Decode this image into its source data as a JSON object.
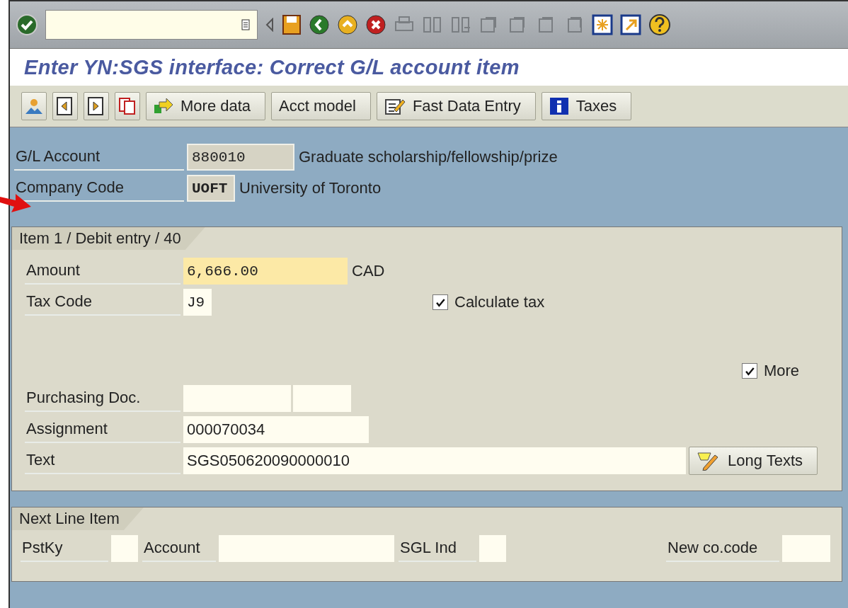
{
  "title": "Enter YN:SGS interface: Correct G/L account item",
  "app_toolbar": [
    {
      "kind": "icon"
    },
    {
      "kind": "icon"
    },
    {
      "kind": "icon"
    },
    {
      "kind": "icon"
    },
    {
      "kind": "text",
      "label": "More data"
    },
    {
      "kind": "text",
      "label": "Acct model"
    },
    {
      "kind": "text",
      "label": "Fast Data Entry"
    },
    {
      "kind": "text",
      "label": "Taxes"
    }
  ],
  "header": [
    {
      "label": "G/L Account",
      "value": "880010",
      "description": "Graduate scholarship/fellowship/prize"
    },
    {
      "label": "Company Code",
      "value": "UOFT",
      "description": "University of Toronto"
    }
  ],
  "item_group": {
    "title": "Item 1 / Debit entry / 40",
    "amount": {
      "label": "Amount",
      "value": "6,666.00",
      "unit": "CAD",
      "kind": "required"
    },
    "tax_code": {
      "label": "Tax Code",
      "value": "J9"
    },
    "calculate_tax": {
      "label": "Calculate tax",
      "checked": true
    },
    "more": {
      "label": "More",
      "checked": true
    },
    "purchasing_doc": {
      "label": "Purchasing Doc."
    },
    "assignment": {
      "label": "Assignment",
      "value": "000070034"
    },
    "text": {
      "label": "Text",
      "value": "SGS050620090000010"
    },
    "long_texts_button": "Long Texts"
  },
  "next_line_item": {
    "title": "Next Line Item",
    "fields": [
      {
        "label": "PstKy"
      },
      {
        "label": "Account"
      },
      {
        "label": "SGL Ind"
      },
      {
        "label": "New co.code"
      }
    ]
  }
}
